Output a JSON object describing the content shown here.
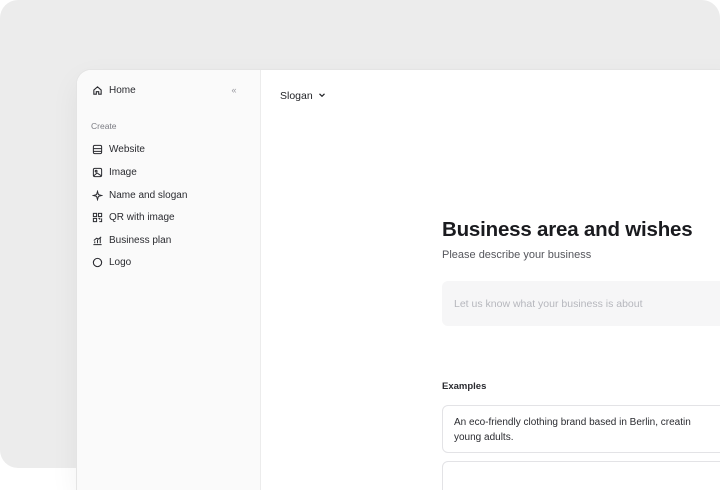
{
  "sidebar": {
    "home_label": "Home",
    "collapse_glyph": "«",
    "section_label": "Create",
    "items": [
      {
        "label": "Website",
        "icon": "website-icon"
      },
      {
        "label": "Image",
        "icon": "image-icon"
      },
      {
        "label": "Name and slogan",
        "icon": "sparkle-icon"
      },
      {
        "label": "QR with image",
        "icon": "qr-icon"
      },
      {
        "label": "Business plan",
        "icon": "chart-icon"
      },
      {
        "label": "Logo",
        "icon": "logo-circle-icon"
      }
    ]
  },
  "main": {
    "doc_type": "Slogan",
    "heading": "Business area and wishes",
    "subheading": "Please describe your business",
    "input_placeholder": "Let us know what your business is about",
    "examples_label": "Examples",
    "example_line1": "An eco-friendly clothing brand based in Berlin, creatin",
    "example_line2": "young adults."
  },
  "colors": {
    "backdrop": "#ececec",
    "sidebar_bg": "#fafafa",
    "input_bg": "#f6f6f7",
    "text_primary": "#1a1b1f",
    "text_muted": "#7a7b82"
  }
}
